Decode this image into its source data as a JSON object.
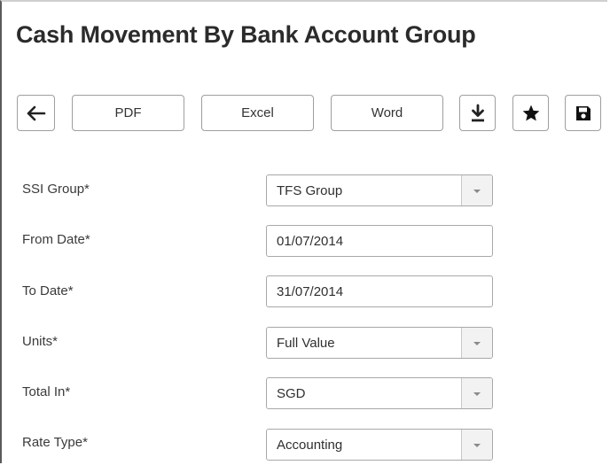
{
  "page": {
    "title": "Cash Movement By Bank Account Group"
  },
  "toolbar": {
    "back_icon": "arrow-left-icon",
    "pdf_label": "PDF",
    "excel_label": "Excel",
    "word_label": "Word",
    "download_icon": "download-icon",
    "favorite_icon": "star-icon",
    "save_icon": "floppy-disk-icon"
  },
  "form": {
    "ssi_group": {
      "label": "SSI Group*",
      "value": "TFS Group",
      "type": "select"
    },
    "from_date": {
      "label": "From Date*",
      "value": "01/07/2014",
      "type": "input"
    },
    "to_date": {
      "label": "To Date*",
      "value": "31/07/2014",
      "type": "input"
    },
    "units": {
      "label": "Units*",
      "value": "Full Value",
      "type": "select"
    },
    "total_in": {
      "label": "Total In*",
      "value": "SGD",
      "type": "select"
    },
    "rate_type": {
      "label": "Rate Type*",
      "value": "Accounting",
      "type": "select"
    }
  },
  "colors": {
    "border": "#9e9e9e",
    "text": "#333333",
    "title": "#2b2b2b",
    "arrow_bg": "#f2f2f2"
  }
}
